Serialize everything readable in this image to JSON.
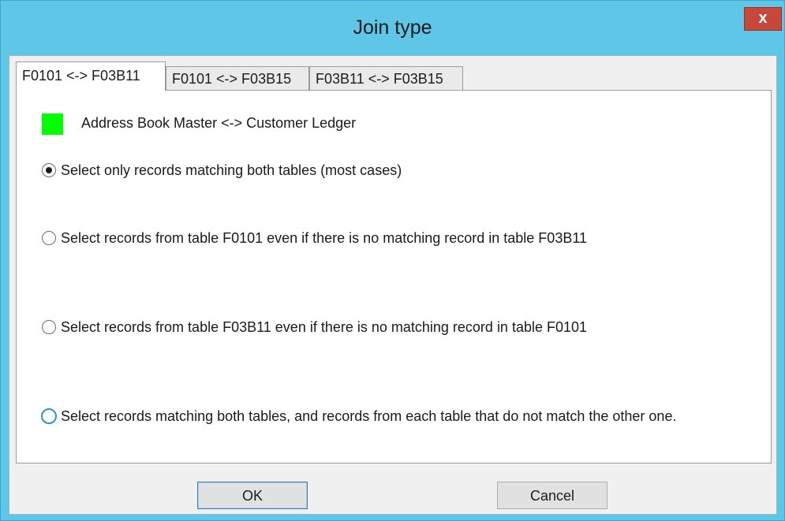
{
  "window": {
    "title": "Join type",
    "close_label": "x"
  },
  "tabs": [
    {
      "label": "F0101 <-> F03B11",
      "active": true
    },
    {
      "label": "F0101 <-> F03B15",
      "active": false
    },
    {
      "label": "F03B11 <-> F03B15",
      "active": false
    }
  ],
  "relation": {
    "label": "Address Book Master <-> Customer Ledger",
    "color": "#00ff00"
  },
  "options": [
    {
      "label": "Select only records matching both tables (most cases)",
      "selected": true
    },
    {
      "label": "Select records from table  F0101 even if there is no matching record in table F03B11",
      "selected": false
    },
    {
      "label": "Select records from table  F03B11 even if there is no matching record in table F0101",
      "selected": false
    },
    {
      "label": "Select records matching both tables, and records from each table that do not match the other one.",
      "selected": false,
      "focused": true
    }
  ],
  "buttons": {
    "ok": "OK",
    "cancel": "Cancel"
  },
  "colors": {
    "titlebar": "#5fc6e8",
    "close_button": "#c7483a",
    "swatch": "#00ff00",
    "focus_ring": "#2f8fd0"
  }
}
